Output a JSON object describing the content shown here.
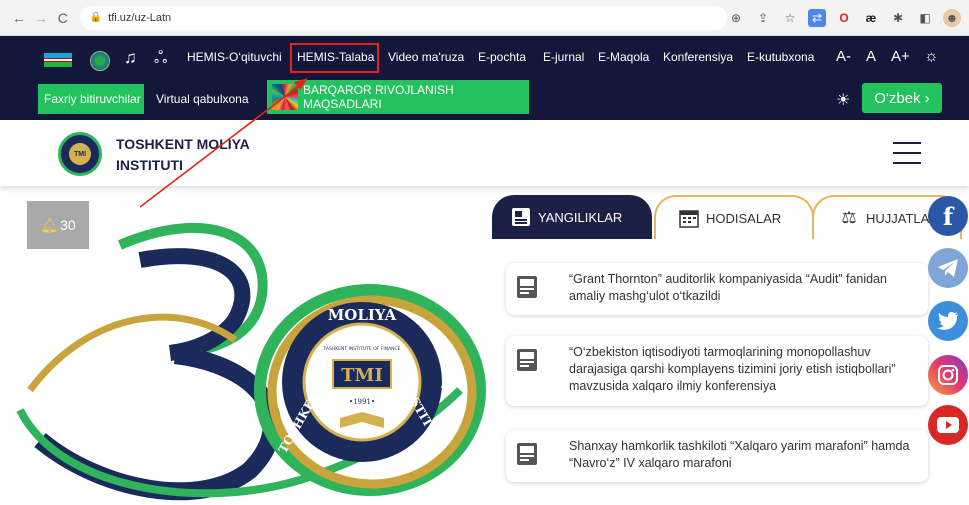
{
  "browser": {
    "url": "tfi.uz/uz-Latn"
  },
  "nav": {
    "links": [
      "HEMIS-O‘qituvchi",
      "HEMIS-Talaba",
      "Video ma'ruza",
      "E-pochta",
      "E-jurnal",
      "E-Maqola",
      "Konferensiya",
      "E-kutubxona"
    ],
    "font_controls": [
      "A-",
      "A",
      "A+"
    ],
    "faxriy": "Faxriy bitiruvchilar",
    "virtual": "Virtual qabulxona",
    "barqaror": "BARQAROR RIVOJLANISH MAQSADLARI",
    "language": "O'zbek ›"
  },
  "logo": {
    "line1": "TOSHKENT MOLIYA",
    "line2": "INSTITUTI",
    "seal_text": "TMI"
  },
  "notification": {
    "count": "30"
  },
  "hero": {
    "number": "30",
    "seal_top": "MOLIYA",
    "seal_left": "TOSHKENT",
    "seal_right": "INSTITUTI",
    "seal_sub": "TASHKENT INSTITUTE OF FINANCE",
    "seal_center": "TMI",
    "seal_year": "•1991•"
  },
  "tabs": [
    "YANGILIKLAR",
    "HODISALAR",
    "HUJJATLAR"
  ],
  "news": [
    "“Grant Thornton” auditorlik kompaniyasida “Audit” fanidan amaliy mashg‘ulot o‘tkazildi",
    "“O‘zbekiston iqtisodiyoti tarmoqlarining monopollashuv darajasiga qarshi komplayens tizimini joriy etish istiqbollari” mavzusida xalqaro ilmiy konferensiya",
    "Shanxay hamkorlik tashkiloti “Xalqaro yarim marafoni” hamda “Navro‘z” IV xalqaro marafoni"
  ],
  "social": [
    "facebook-icon",
    "telegram-icon",
    "twitter-icon",
    "instagram-icon",
    "youtube-icon"
  ],
  "colors": {
    "navy": "#13173a",
    "green": "#22c35e",
    "annotation_red": "#e2231a",
    "gold": "#e2b760"
  }
}
